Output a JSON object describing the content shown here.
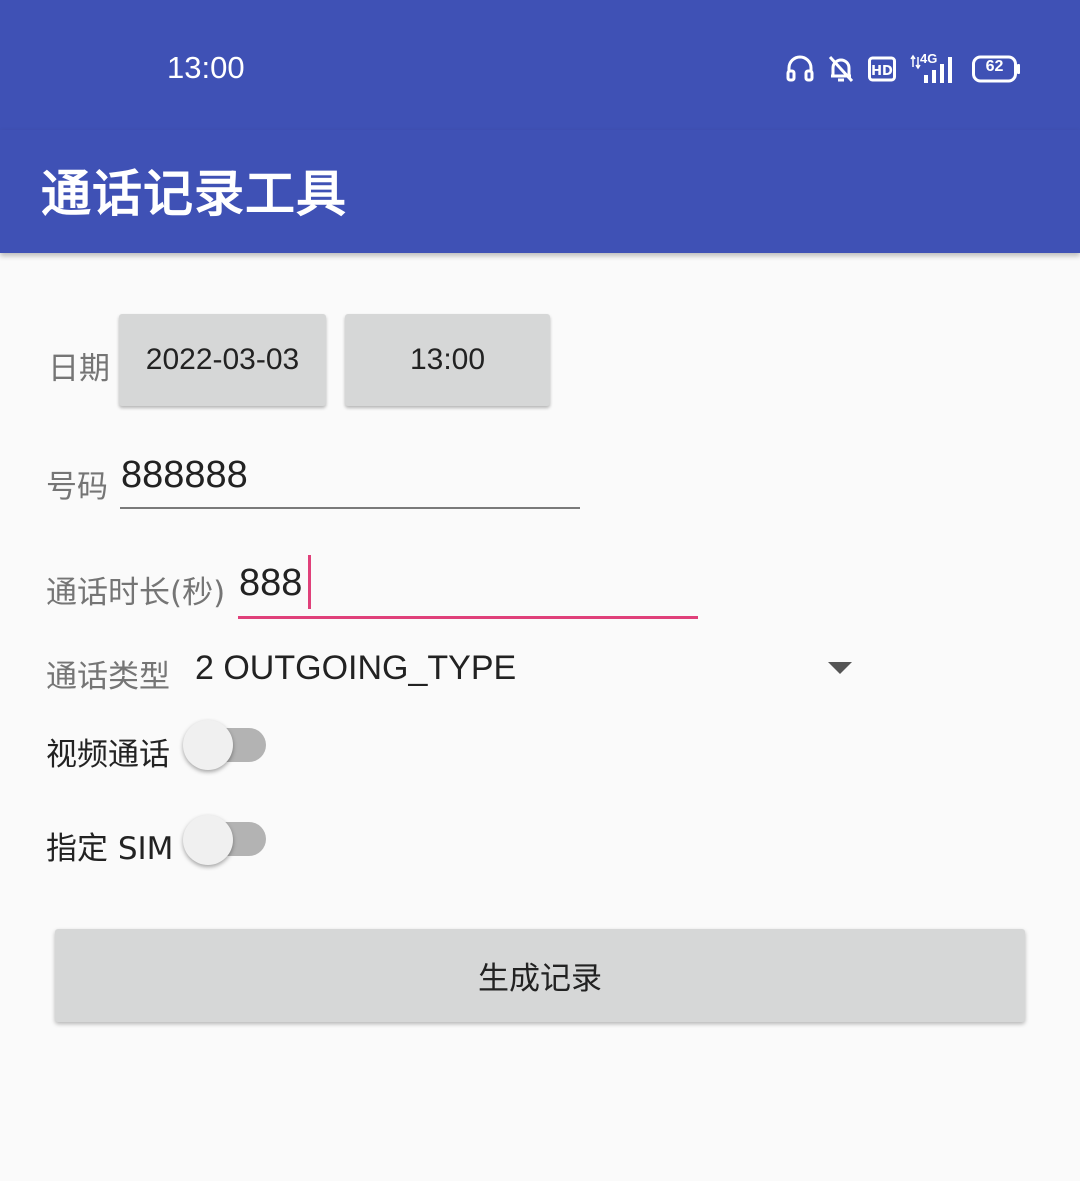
{
  "status_bar": {
    "time": "13:00",
    "network": "4G",
    "battery": "62",
    "icons": [
      "headset-icon",
      "bell-off-icon",
      "hd-icon",
      "signal-icon",
      "battery-icon"
    ]
  },
  "toolbar": {
    "title": "通话记录工具"
  },
  "form": {
    "date_label": "日期",
    "date_value": "2022-03-03",
    "time_value": "13:00",
    "number_label": "号码",
    "number_value": "888888",
    "duration_label": "通话时长(秒)",
    "duration_value": "888",
    "type_label": "通话类型",
    "type_value": "2 OUTGOING_TYPE",
    "video_label": "视频通话",
    "video_on": false,
    "sim_label": "指定 SIM",
    "sim_on": false,
    "generate_label": "生成记录"
  },
  "colors": {
    "primary": "#3f51b5",
    "accent": "#e0407a",
    "button": "#d6d7d7",
    "background": "#fafafa"
  }
}
